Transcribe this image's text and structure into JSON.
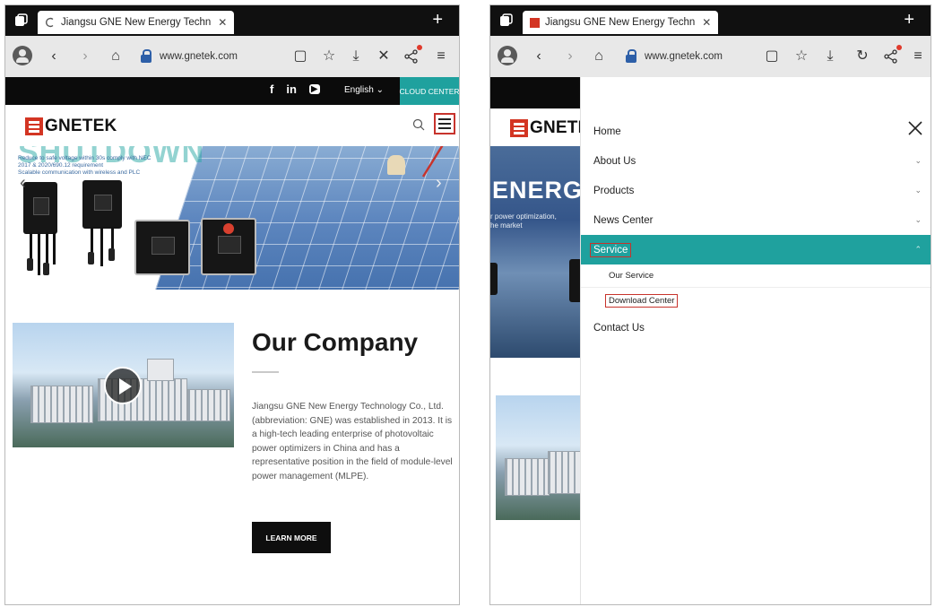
{
  "browser": {
    "tab_title_left": "Jiangsu GNE New Energy Techn",
    "tab_title_right": "Jiangsu GNE New Energy Techn",
    "tab_close": "✕",
    "new_tab": "+",
    "url": "www.gnetek.com",
    "icons": [
      "tabs-icon",
      "profile-icon",
      "back-icon",
      "forward-icon",
      "home-icon",
      "lock-icon",
      "reader-icon",
      "star-icon",
      "download-icon",
      "stop-icon",
      "reload-icon",
      "share-icon",
      "menu-icon"
    ],
    "back_glyph": "‹",
    "forward_glyph": "›",
    "home_glyph": "⌂",
    "reader_glyph": "▢",
    "star_glyph": "☆",
    "download_glyph": "⤓",
    "stop_glyph": "✕",
    "reload_glyph": "↻",
    "share_glyph": "<°",
    "menu_glyph": "≡"
  },
  "site": {
    "top_bar": {
      "social": [
        "f",
        "in",
        "▶"
      ],
      "language": "English ⌄",
      "cloud_center": "CLOUD CENTER"
    },
    "logo_text": "GNETEK",
    "logo_text_cut": "GNETE",
    "colors": {
      "accent": "#1fa19e",
      "brand_red": "#d33523",
      "highlight": "#c7332c"
    }
  },
  "hero": {
    "heading": "SHUTDOWN",
    "description_lines": [
      "Reduce to safe voltage within 30s comply with NEC",
      "2017 & 2020/690.12 requirement",
      "Scalable communication with wireless and PLC"
    ],
    "prev": "‹",
    "next": "›"
  },
  "background_hero": {
    "word": "ENERG",
    "sub_lines": [
      "r power optimization,",
      "he market"
    ]
  },
  "company": {
    "title": "Our Company",
    "text": "Jiangsu GNE New Energy Technology Co., Ltd. (abbreviation: GNE) was established in 2013. It is a high-tech leading enterprise of photovoltaic power optimizers in China and has a representative position in the field of module-level power management (MLPE).",
    "learn_more": "LEARN MORE"
  },
  "menu": {
    "close": "✕",
    "items": [
      {
        "label": "Home",
        "chev": ""
      },
      {
        "label": "About Us",
        "chev": "⌄"
      },
      {
        "label": "Products",
        "chev": "⌄"
      },
      {
        "label": "News Center",
        "chev": "⌄"
      },
      {
        "label": "Service",
        "chev": "⌃"
      },
      {
        "label": "Contact Us",
        "chev": ""
      }
    ],
    "service_sub": [
      {
        "label": "Our Service"
      },
      {
        "label": "Download Center"
      }
    ]
  }
}
